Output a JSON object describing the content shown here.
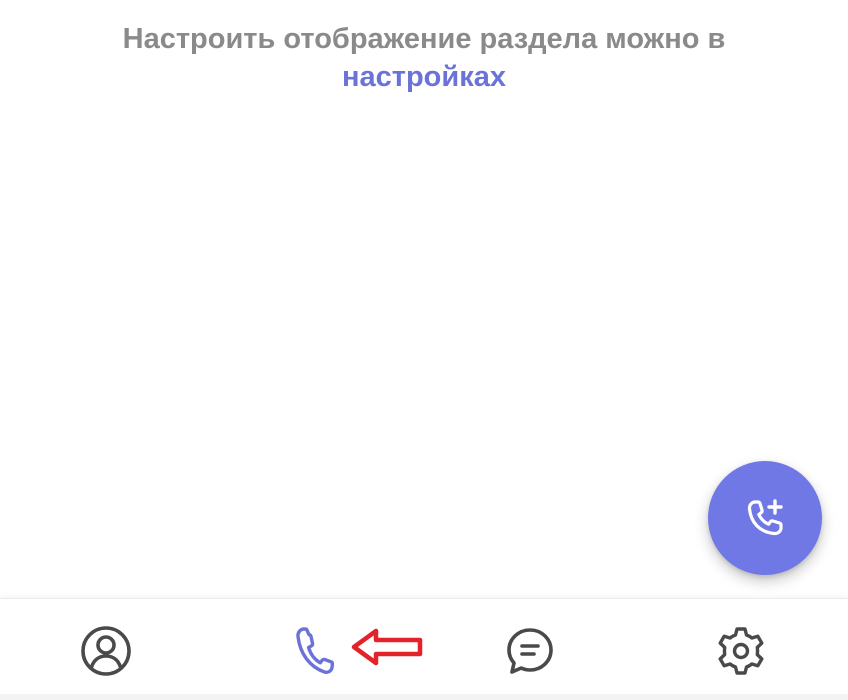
{
  "hint": {
    "text": "Настроить отображение раздела можно в ",
    "link": "настройках"
  },
  "fab": {
    "icon": "phone-add-icon",
    "color": "#7078e6"
  },
  "bottom_nav": {
    "active": "calls",
    "active_color": "#6b73d9",
    "inactive_color": "#4a4a4a",
    "items": [
      {
        "id": "profile",
        "icon": "user-circle-icon"
      },
      {
        "id": "calls",
        "icon": "phone-icon"
      },
      {
        "id": "chats",
        "icon": "chat-bubble-icon"
      },
      {
        "id": "settings",
        "icon": "gear-icon"
      }
    ]
  },
  "annotation": {
    "icon": "red-arrow-left-icon",
    "color": "#e3222a"
  }
}
